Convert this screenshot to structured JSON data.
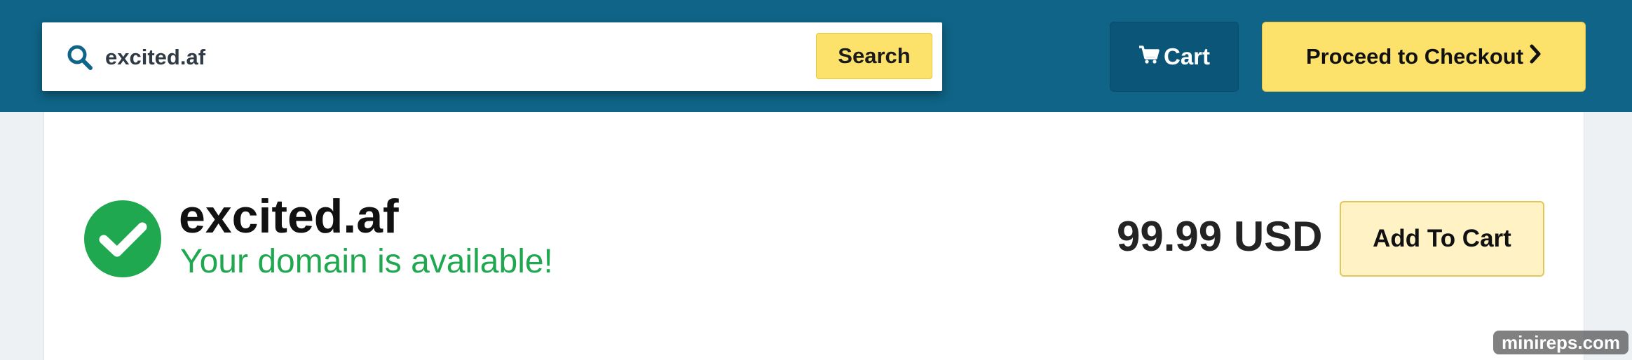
{
  "search": {
    "value": "excited.af",
    "button_label": "Search"
  },
  "header": {
    "cart_label": "Cart",
    "checkout_label": "Proceed to Checkout"
  },
  "result": {
    "domain": "excited.af",
    "status": "Your domain is available!",
    "price": "99.99 USD",
    "add_to_cart_label": "Add To Cart"
  },
  "watermark": {
    "text": "minireps.com"
  },
  "colors": {
    "header_bg": "#0f6487",
    "accent_yellow": "#fce26b",
    "success_green": "#1fa84f",
    "cart_bg": "#0b5678"
  },
  "icons": {
    "search": "search-icon",
    "cart": "cart-icon",
    "checkout": "chevron-right-icon",
    "available": "check-circle-icon"
  }
}
